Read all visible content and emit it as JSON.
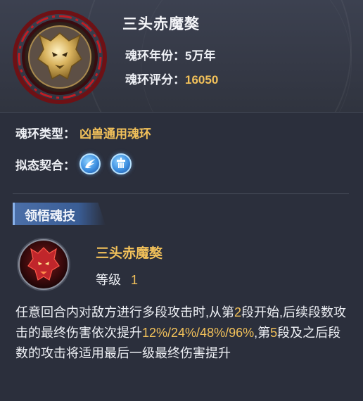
{
  "soul_ring": {
    "name": "三头赤魔獒",
    "year_label": "魂环年份：",
    "year_value": "5万年",
    "score_label": "魂环评分：",
    "score_value": "16050"
  },
  "properties": {
    "type_label": "魂环类型：",
    "type_value": "凶兽通用魂环",
    "mimic_label": "拟态契合：",
    "mimic_icons": [
      "wing-icon",
      "tower-icon"
    ]
  },
  "section": {
    "title": "领悟魂技"
  },
  "skill": {
    "name": "三头赤魔獒",
    "level_label": "等级",
    "level_value": "1",
    "description": [
      {
        "text": "任意回合内对敌方进行多段攻击时,从第",
        "hl": false
      },
      {
        "text": "2",
        "hl": true
      },
      {
        "text": "段开始,后续段数攻击的最终伤害依次提升",
        "hl": false
      },
      {
        "text": "12%/24%/48%/96%",
        "hl": true
      },
      {
        "text": ",第",
        "hl": false
      },
      {
        "text": "5",
        "hl": true
      },
      {
        "text": "段及之后段数的攻击将适用最后一级最终伤害提升",
        "hl": false
      }
    ]
  },
  "colors": {
    "gold": "#f2c15a",
    "background": "#2b2f3c",
    "accent_blue": "#3d8fe0"
  }
}
